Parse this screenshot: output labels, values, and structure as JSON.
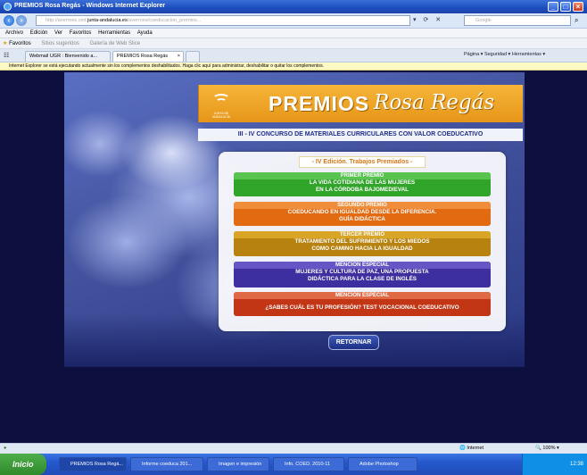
{
  "window": {
    "title": "PREMIOS Rosa Regás - Windows Internet Explorer"
  },
  "address": {
    "url_prefix": "http://",
    "url_grey1": "averroes.ced.",
    "url_domain": "junta-andalucia.es",
    "url_grey2": "/averroes/coeducacion_premios...",
    "search_placeholder": "Google"
  },
  "menu": [
    "Archivo",
    "Edición",
    "Ver",
    "Favoritos",
    "Herramientas",
    "Ayuda"
  ],
  "favorites": {
    "label": "Favoritos",
    "sites": "Sitios sugeridos",
    "gallery": "Galería de Web Slice"
  },
  "tabs": [
    {
      "label": "Webmail UGR : Bienvenido a..."
    },
    {
      "label": "PREMIOS Rosa Regás"
    }
  ],
  "commandbar": "Página ▾   Seguridad ▾   Herramientas ▾",
  "infobar": "Internet Explorer se está ejecutando actualmente sin los complementos deshabilitados. Haga clic aquí para administrar, deshabilitar o quitar los complementos.",
  "header": {
    "premios": "PREMIOS",
    "rosa": "Rosa Regás",
    "logo_text": "JUNTA DE ANDALUCÍA"
  },
  "subtitle": "III - IV CONCURSO DE MATERIALES CURRICULARES CON VALOR COEDUCATIVO",
  "edition": "- IV Edición. Trabajos Premiados -",
  "awards": [
    {
      "head": "PRIMER PREMIO",
      "line1": "LA VIDA COTIDIANA DE LAS MUJERES",
      "line2": "EN LA CÓRDOBA BAJOMEDIEVAL"
    },
    {
      "head": "SEGUNDO PREMIO",
      "line1": "COEDUCANDO EN IGUALDAD DESDE LA DIFERENCIA.",
      "line2": "GUÍA DIDÁCTICA"
    },
    {
      "head": "TERCER PREMIO",
      "line1": "TRATAMIENTO DEL SUFRIMIENTO Y LOS MIEDOS",
      "line2": "COMO CAMINO HACIA LA IGUALDAD"
    },
    {
      "head": "MENCIÓN ESPECIAL",
      "line1": "MUJERES Y CULTURA DE PAZ, UNA PROPUESTA",
      "line2": "DIDÁCTICA PARA LA CLASE DE INGLÉS"
    },
    {
      "head": "MENCIÓN ESPECIAL",
      "line1": "¿SABES CUÁL ES TU PROFESIÓN? TEST VOCACIONAL COEDUCATIVO"
    }
  ],
  "retornar": "RETORNAR",
  "status": {
    "zone": "Internet",
    "zoom": "100%"
  },
  "taskbar": {
    "start": "Inicio",
    "tasks": [
      "PREMIOS Rosa Regá...",
      "Informe coeduca 201...",
      "Imagen e impresión",
      "Info. COED. 2010-11",
      "Adobe Photoshop"
    ],
    "clock": "12:38"
  }
}
